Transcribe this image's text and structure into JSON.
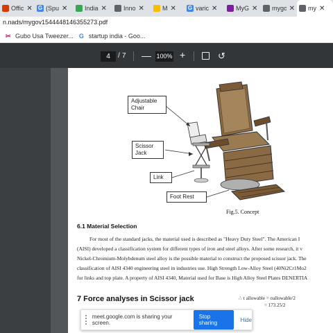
{
  "tabs": [
    {
      "label": "Offic",
      "icon": "office-icon",
      "color": "#d83b01",
      "glyph": ""
    },
    {
      "label": "(Spu",
      "icon": "google-icon",
      "color": "#4285f4",
      "glyph": "G"
    },
    {
      "label": "India",
      "icon": "site-icon",
      "color": "#34a853",
      "glyph": ""
    },
    {
      "label": "Inno",
      "icon": "site-icon",
      "color": "#5f6368",
      "glyph": ""
    },
    {
      "label": "M",
      "icon": "site-icon",
      "color": "#fbbc04",
      "glyph": ""
    },
    {
      "label": "varic",
      "icon": "google-icon",
      "color": "#4285f4",
      "glyph": "G"
    },
    {
      "label": "MyG",
      "icon": "site-icon",
      "color": "#7b1fa2",
      "glyph": ""
    },
    {
      "label": "mygo",
      "icon": "globe-icon",
      "color": "#5f6368",
      "glyph": ""
    },
    {
      "label": "my",
      "icon": "globe-icon",
      "color": "#5f6368",
      "glyph": ""
    }
  ],
  "tab_close": "✕",
  "address": "n.nads/mygov1544448146355273.pdf",
  "bookmarks": [
    {
      "label": "Gubo Usa Tweezer...",
      "icon": "bookmark-icon",
      "glyph": "✂"
    },
    {
      "label": "startup india - Goo...",
      "icon": "google-icon",
      "glyph": "G"
    }
  ],
  "pdf_toolbar": {
    "page_current": "4",
    "page_sep": "/",
    "page_total": "7",
    "zoom_out": "—",
    "zoom": "100%",
    "zoom_in": "+",
    "rotate": "↺"
  },
  "figure": {
    "labels": {
      "chair": "Adjustable Chair",
      "jack": "Scissor Jack",
      "link": "Link",
      "footrest": "Foot Rest"
    },
    "caption": "Fig.5. Concept"
  },
  "section_61": {
    "heading": "6.1 Material Selection",
    "lines": [
      "For most of the standard jacks, the material used is described as \"Heavy Duty Steel\". The American I",
      "(AISI) developed a classification system for different types of iron and steel alloys. After some research, it v",
      "Nickel-Chromium-Molybdenum steel alloy is the possible material to construct the proposed scissor jack. The",
      "classification of AISI 4340 engineering steel in industries use. High Strength Low-Alloy Steel (40Ni2Cr1Mo2",
      "for links and top plate. A property of AISI 4340, Material used for Base is High Alloy Steel Plates DENERTIA"
    ]
  },
  "section_7": {
    "heading": "7 Force analyses in Scissor jack",
    "formula_lines": [
      "∴ τ allowable    = σallowable/2",
      "= 173.25/2"
    ]
  },
  "share_bar": {
    "message": "meet.google.com is sharing your screen.",
    "stop": "Stop sharing",
    "hide": "Hide"
  }
}
